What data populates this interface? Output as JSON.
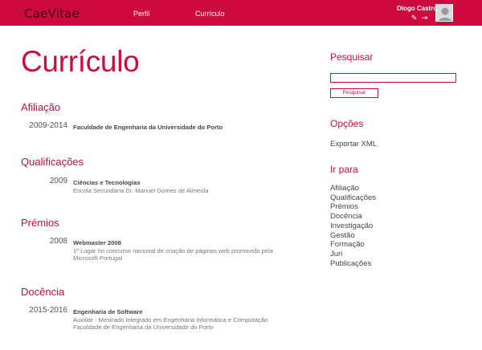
{
  "header": {
    "logo": "CaeVitae",
    "nav": [
      "Perfil",
      "Currículo"
    ],
    "user_name": "Diogo Castro",
    "edit_icon": "✎",
    "logout_icon": "⇥"
  },
  "page_title": "Currículo",
  "sections": {
    "afiliacao": {
      "title": "Afiliação",
      "entries": [
        {
          "year": "2009-2014",
          "title": "Faculdade de Engenharia da Universidade do Porto",
          "lines": []
        }
      ]
    },
    "qualificacoes": {
      "title": "Qualificações",
      "entries": [
        {
          "year": "2009",
          "title": "Ciências e Tecnologias",
          "lines": [
            "Escola Secundária Dr. Manuel Gomes de Almeida"
          ]
        }
      ]
    },
    "premios": {
      "title": "Prémios",
      "entries": [
        {
          "year": "2008",
          "title": "Webmaster 2008",
          "lines": [
            "1º Lugar no concurso nacional de criação de páginas web promovido pela",
            "Microsoft Portugal"
          ]
        }
      ]
    },
    "docencia": {
      "title": "Docência",
      "entries": [
        {
          "year": "2015-2016",
          "title": "Engenharia de Software",
          "lines": [
            "Auxiliar - Mestrado Integrado em Engenharia Informática e Computação",
            "Faculdade de Engenharia da Universidade do Porto"
          ]
        }
      ]
    }
  },
  "sidebar": {
    "search_title": "Pesquisar",
    "search_value": "",
    "search_button": "Pesquisar",
    "options_title": "Opções",
    "export_label": "Exportar XML",
    "goto_title": "Ir para",
    "goto_items": [
      "Afiliação",
      "Qualificações",
      "Prémios",
      "Docência",
      "Investigação",
      "Gestão",
      "Formação",
      "Juri",
      "Publicações"
    ]
  },
  "colors": {
    "accent": "#cc0a3c",
    "logo_text": "#3a0010",
    "text": "#444444",
    "muted": "#777777"
  }
}
